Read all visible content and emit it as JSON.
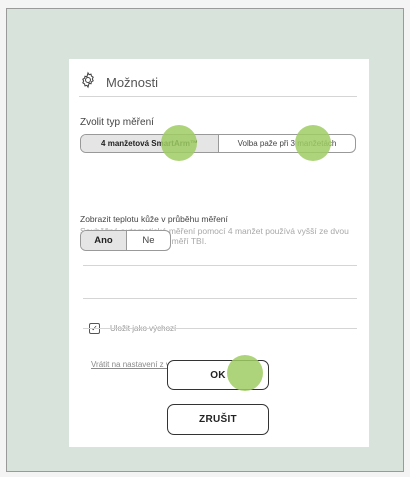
{
  "dialog": {
    "title": "Možnosti",
    "icon": "gear-icon"
  },
  "measurement_type": {
    "label": "Zvolit typ měření",
    "options": [
      "4 manžetová SmartArm™",
      "Volba paže při 3 manžetách"
    ],
    "selected": 0,
    "description": "Souběžné automatické měření pomocí 4 manžet používá vyšší ze dvou krevních tlaků na paži a měří TBI."
  },
  "skin_temperature": {
    "label": "Zobrazit teplotu kůže v průběhu měření",
    "options": [
      "Ano",
      "Ne"
    ],
    "selected": 0
  },
  "save_default": {
    "label": "Uložit jako výchozí",
    "checked": true,
    "check_glyph": "✓"
  },
  "reset_link": "Vrátit na nastavení z výroby?",
  "buttons": {
    "ok": "OK",
    "cancel": "ZRUŠIT"
  },
  "colors": {
    "background": "#d8e3dc",
    "touch_marker": "#a0cd64"
  }
}
